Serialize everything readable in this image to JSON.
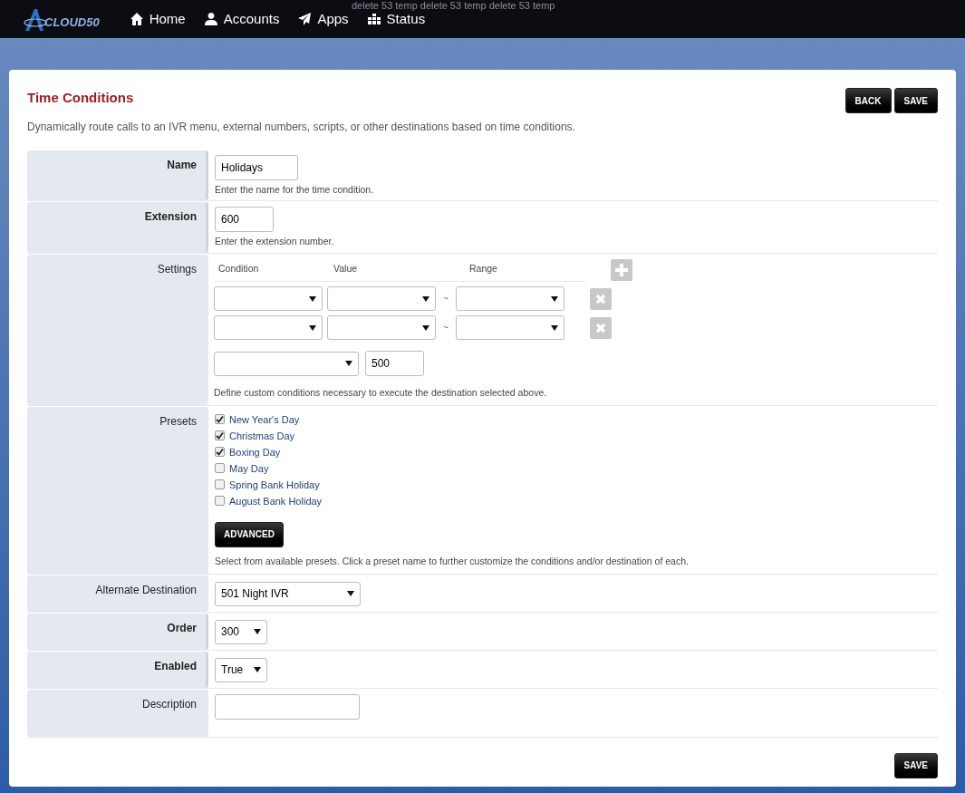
{
  "navbar": {
    "logo": "CLOUD50",
    "items": [
      {
        "label": "Home"
      },
      {
        "label": "Accounts"
      },
      {
        "label": "Apps"
      },
      {
        "label": "Status"
      }
    ],
    "overlay_text": "delete 53 temp delete 53 temp delete 53 temp"
  },
  "page": {
    "title": "Time Conditions",
    "description": "Dynamically route calls to an IVR menu, external numbers, scripts, or other destinations based on time conditions.",
    "buttons": [
      "BACK",
      "SAVE"
    ]
  },
  "form": [
    {
      "kind": "text",
      "label": "Name",
      "required": true,
      "value": "Holidays",
      "help": "Enter the name for the time condition."
    },
    {
      "kind": "text",
      "label": "Extension",
      "required": true,
      "value": "600",
      "help": "Enter the extension number."
    },
    {
      "kind": "settings",
      "label": "Settings",
      "required": false,
      "columns": [
        "Condition",
        "Value",
        "Range"
      ],
      "rows": [
        {
          "separator": "~"
        },
        {
          "separator": "~"
        }
      ],
      "destination_value": "500",
      "help": "Define custom conditions necessary to execute the destination selected above."
    },
    {
      "kind": "presets",
      "label": "Presets",
      "required": false,
      "options": [
        {
          "label": "New Year's Day",
          "checked": true
        },
        {
          "label": "Christmas Day",
          "checked": true
        },
        {
          "label": "Boxing Day",
          "checked": true
        },
        {
          "label": "May Day",
          "checked": false
        },
        {
          "label": "Spring Bank Holiday",
          "checked": false
        },
        {
          "label": "August Bank Holiday",
          "checked": false
        }
      ],
      "button": "ADVANCED",
      "help": "Select from available presets. Click a preset name to further customize the conditions and/or destination of each."
    },
    {
      "kind": "select",
      "label": "Alternate Destination",
      "required": false,
      "value": "501 Night IVR"
    },
    {
      "kind": "select",
      "label": "Order",
      "required": true,
      "value": "300"
    },
    {
      "kind": "select",
      "label": "Enabled",
      "required": true,
      "value": "True"
    },
    {
      "kind": "text",
      "label": "Description",
      "required": false
    }
  ],
  "footer_button": "SAVE"
}
